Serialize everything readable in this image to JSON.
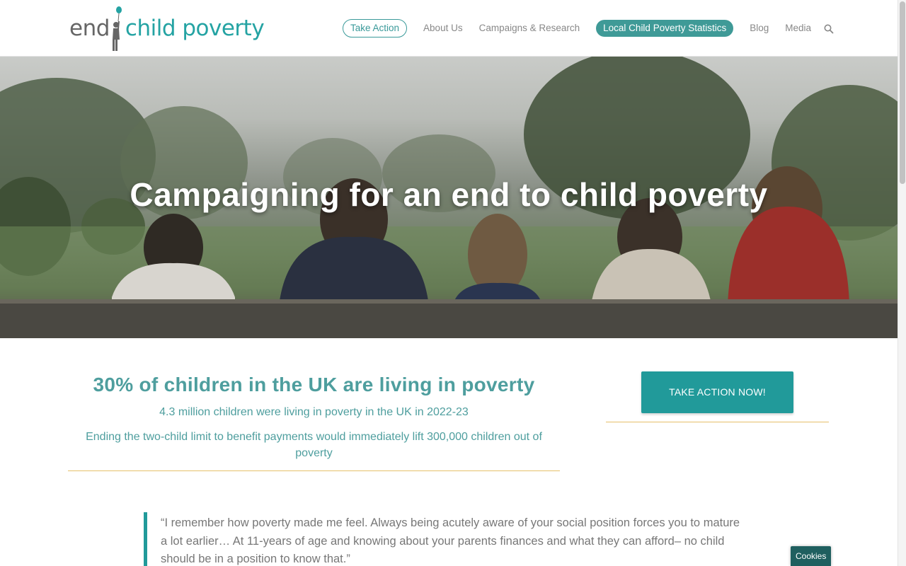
{
  "logo": {
    "word_end": "end",
    "word_rest": "child poverty"
  },
  "nav": {
    "items": [
      {
        "label": "Take Action",
        "style": "outline"
      },
      {
        "label": "About Us",
        "style": "plain"
      },
      {
        "label": "Campaigns & Research",
        "style": "plain"
      },
      {
        "label": "Local Child Poverty Statistics",
        "style": "filled"
      },
      {
        "label": "Blog",
        "style": "plain"
      },
      {
        "label": "Media",
        "style": "plain"
      }
    ],
    "search_icon": "search-icon"
  },
  "hero": {
    "title": "Campaigning for an end to child poverty"
  },
  "stats": {
    "headline": "30% of children in the UK are living in poverty",
    "line1": "4.3 million children were living in poverty in the UK in 2022-23",
    "line2": "Ending the two-child limit to benefit payments would immediately lift 300,000 children out of poverty"
  },
  "cta": {
    "label": "TAKE ACTION NOW!"
  },
  "quote": {
    "text": "“I remember how poverty made me feel. Always being acutely aware of your social position forces you to mature a lot earlier…  At 11-years of age and knowing about your parents finances and what they can afford– no child should be in a position to know that.”"
  },
  "cookies": {
    "label": "Cookies"
  },
  "colors": {
    "brand_teal": "#219a9a",
    "nav_filled": "#3f9a97",
    "accent_rule": "#e6c06a",
    "text_teal": "#4e9e9e"
  }
}
